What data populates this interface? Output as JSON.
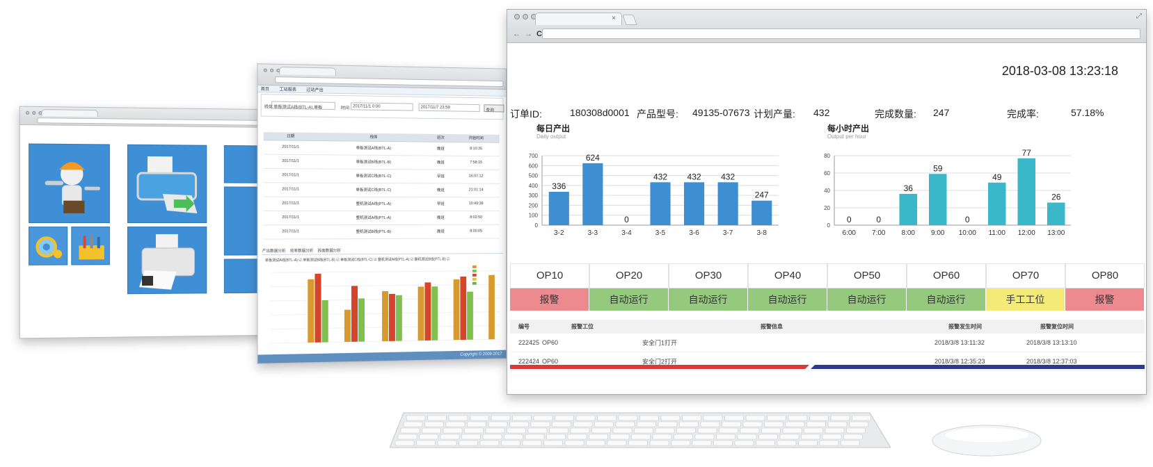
{
  "w2": {
    "menu": [
      "首页",
      "工站报表",
      "过站产出"
    ],
    "query": {
      "line_label": "线体",
      "line_value": "单板测试A线(BTL-A),单板",
      "time_label": "时间",
      "time_from": "2017/11/1 0:00",
      "time_to": "2017/11/7 23:59",
      "search_label": "查询"
    },
    "table_headers": [
      "日期",
      "线体",
      "班次",
      "开始时间"
    ],
    "table_rows": [
      [
        "2017/11/1",
        "单板测试A线(BTL-A)",
        "晚班",
        "8:10:35"
      ],
      [
        "2017/11/1",
        "单板测试B线(BTL-B)",
        "晚班",
        "7:58:15"
      ],
      [
        "2017/11/1",
        "单板测试C线(BTL-C)",
        "早班",
        "15:07:12"
      ],
      [
        "2017/11/1",
        "单板测试C线(BTL-C)",
        "晚班",
        "21:01:14"
      ],
      [
        "2017/11/1",
        "整机测试A线(PTL-A)",
        "早班",
        "10:49:38"
      ],
      [
        "2017/11/1",
        "整机测试A线(PTL-A)",
        "晚班",
        "8:02:50"
      ],
      [
        "2017/11/1",
        "整机测试B线(PTL-B)",
        "晚班",
        "8:00:05"
      ]
    ],
    "subtabs": [
      "产出数据分析",
      "效率数据分析",
      "拆面数据分析"
    ],
    "legend": "单板测试A线(BTL-A) ☑  单板测试B线(BTL-B) ☑  单板测试C线(BTL-C) ☑  整机测试A线(PTL-A) ☑  整机测试B线(PTL-B) ☑",
    "footer": "Copyright © 2009-2017"
  },
  "header": {
    "datetime": "2018-03-08 13:23:18"
  },
  "order": {
    "id_label": "订单ID:",
    "id_value": "180308d0001",
    "model_label": "产品型号:",
    "model_value": "49135-07673",
    "plan_label": "计划产量:",
    "plan_value": "432",
    "done_label": "完成数量:",
    "done_value": "247",
    "rate_label": "完成率:",
    "rate_value": "57.18%"
  },
  "chart_data": [
    {
      "type": "bar",
      "title": "每日产出",
      "subtitle": "Daily output",
      "categories": [
        "3-2",
        "3-3",
        "3-4",
        "3-5",
        "3-6",
        "3-7",
        "3-8"
      ],
      "values": [
        336,
        624,
        0,
        432,
        432,
        432,
        247
      ],
      "ylim": [
        0,
        700
      ],
      "yticks": [
        0,
        100,
        200,
        300,
        400,
        500,
        600,
        700
      ],
      "color": "#3d8fd1",
      "grid": true
    },
    {
      "type": "bar",
      "title": "每小时产出",
      "subtitle": "Output per hour",
      "categories": [
        "6:00",
        "7:00",
        "8:00",
        "9:00",
        "10:00",
        "11:00",
        "12:00",
        "13:00"
      ],
      "values": [
        0,
        0,
        36,
        59,
        0,
        49,
        77,
        26
      ],
      "ylim": [
        0,
        80
      ],
      "yticks": [
        0,
        20,
        40,
        60,
        80
      ],
      "color": "#3ab7c9",
      "grid": true
    }
  ],
  "ops": [
    {
      "name": "OP10",
      "status": "报警",
      "state": "alarm"
    },
    {
      "name": "OP20",
      "status": "自动运行",
      "state": "auto"
    },
    {
      "name": "OP30",
      "status": "自动运行",
      "state": "auto"
    },
    {
      "name": "OP40",
      "status": "自动运行",
      "state": "auto"
    },
    {
      "name": "OP50",
      "status": "自动运行",
      "state": "auto"
    },
    {
      "name": "OP60",
      "status": "自动运行",
      "state": "auto"
    },
    {
      "name": "OP70",
      "status": "手工工位",
      "state": "manual"
    },
    {
      "name": "OP80",
      "status": "报警",
      "state": "alarm"
    }
  ],
  "alarms": {
    "headers": [
      "编号",
      "报警工位",
      "报警信息",
      "报警发生时间",
      "报警复位时间"
    ],
    "rows": [
      {
        "id": "222425",
        "station": "OP60",
        "info": "安全门1打开",
        "start": "2018/3/8 13:11:32",
        "reset": "2018/3/8 13:13:10"
      },
      {
        "id": "222424",
        "station": "OP60",
        "info": "安全门2打开",
        "start": "2018/3/8 12:35:23",
        "reset": "2018/3/8 12:37:03"
      }
    ]
  },
  "colors": {
    "alarm": "#ec8a8f",
    "auto": "#94c97e",
    "manual": "#f3ea78",
    "stripe_red": "#d83a3a",
    "stripe_blue": "#2c3b8f"
  }
}
